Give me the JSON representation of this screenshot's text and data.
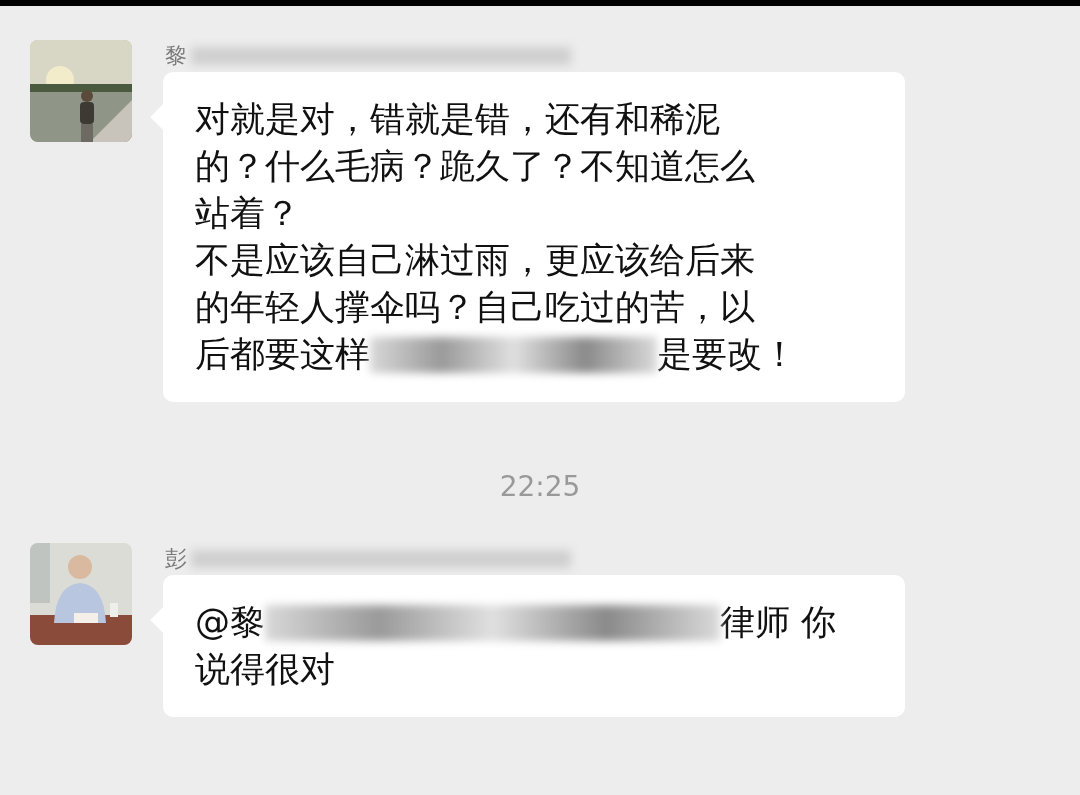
{
  "messages": [
    {
      "kind": "message",
      "sender": "黎",
      "lines": [
        [
          {
            "kind": "text",
            "text": "对就是对，错就是错，还有和稀泥"
          }
        ],
        [
          {
            "kind": "text",
            "text": "的？什么毛病？跪久了？不知道怎么"
          }
        ],
        [
          {
            "kind": "text",
            "text": "站着？"
          }
        ],
        [
          {
            "kind": "text",
            "text": "不是应该自己淋过雨，更应该给后来"
          }
        ],
        [
          {
            "kind": "text",
            "text": "的年轻人撑伞吗？自己吃过的苦，以"
          }
        ],
        [
          {
            "kind": "text",
            "text": "后都要这样"
          },
          {
            "kind": "blur"
          },
          {
            "kind": "text",
            "text": "是要改！"
          }
        ]
      ]
    },
    {
      "kind": "time",
      "text": "22:25"
    },
    {
      "kind": "message",
      "sender": "彭",
      "lines": [
        [
          {
            "kind": "text",
            "text": "@黎"
          },
          {
            "kind": "blur"
          },
          {
            "kind": "text",
            "text": "律师 你"
          }
        ],
        [
          {
            "kind": "text",
            "text": "说得很对"
          }
        ]
      ]
    }
  ]
}
